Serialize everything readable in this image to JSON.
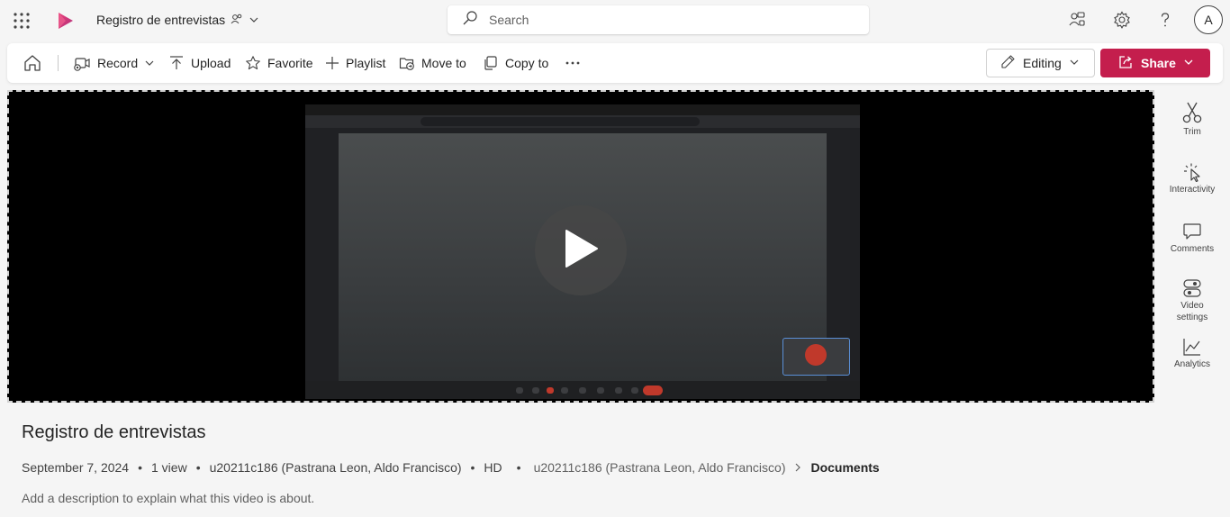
{
  "app": {
    "doc_title": "Registro de entrevistas",
    "search_placeholder": "Search",
    "avatar_initial": "A"
  },
  "commands": {
    "record": "Record",
    "upload": "Upload",
    "favorite": "Favorite",
    "playlist": "Playlist",
    "move_to": "Move to",
    "copy_to": "Copy to",
    "editing": "Editing",
    "share": "Share"
  },
  "side_panel": {
    "trim": "Trim",
    "interactivity": "Interactivity",
    "comments": "Comments",
    "video_settings_line1": "Video",
    "video_settings_line2": "settings",
    "analytics": "Analytics"
  },
  "video": {
    "title": "Registro de entrevistas",
    "date": "September 7, 2024",
    "views": "1 view",
    "owner": "u20211c186 (Pastrana Leon, Aldo Francisco)",
    "quality": "HD",
    "location_owner": "u20211c186 (Pastrana Leon, Aldo Francisco)",
    "location_folder": "Documents",
    "description_placeholder": "Add a description to explain what this video is about."
  },
  "colors": {
    "accent": "#c41e4d",
    "background": "#f5f5f5"
  },
  "icons": [
    "waffle-icon",
    "stream-logo-icon",
    "share-people-icon",
    "search-icon",
    "feedback-icon",
    "settings-icon",
    "help-icon",
    "home-icon",
    "record-icon",
    "upload-icon",
    "star-icon",
    "plus-icon",
    "move-icon",
    "copy-icon",
    "more-icon",
    "pencil-icon",
    "share-icon",
    "scissors-icon",
    "interactivity-icon",
    "comment-icon",
    "video-settings-icon",
    "analytics-icon",
    "play-icon"
  ]
}
